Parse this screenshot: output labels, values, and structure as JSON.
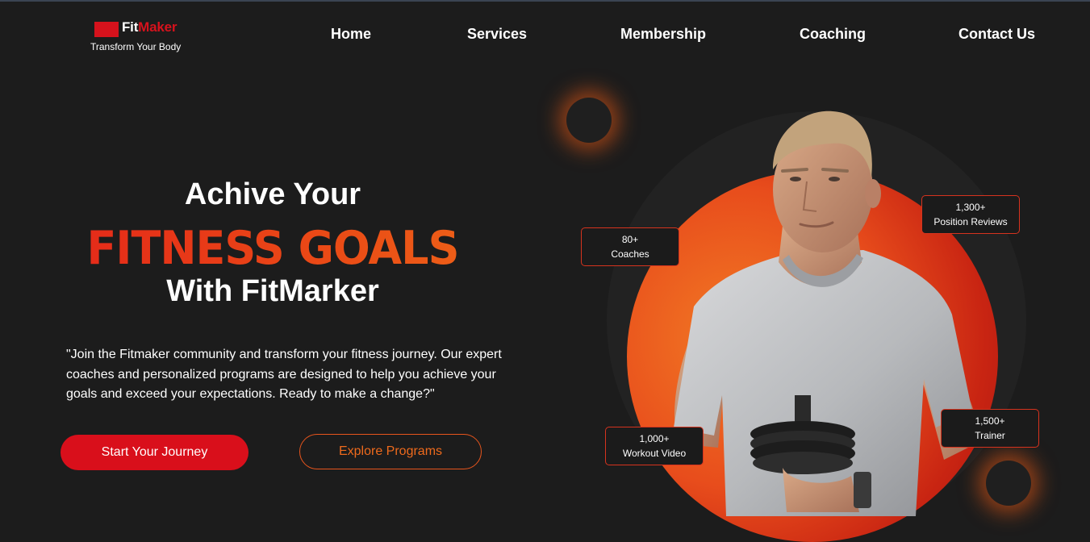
{
  "brand": {
    "name_part1": "Fit",
    "name_part2": "Maker",
    "tagline": "Transform Your Body"
  },
  "nav": [
    {
      "label": "Home"
    },
    {
      "label": "Services"
    },
    {
      "label": "Membership"
    },
    {
      "label": "Coaching"
    },
    {
      "label": "Contact Us"
    }
  ],
  "hero": {
    "line1": "Achive Your",
    "highlight": "FITNESS GOALS",
    "line3": "With FitMarker",
    "description": "\"Join the Fitmaker community and transform your fitness journey. Our expert coaches and personalized programs are designed to help you achieve your goals and exceed your expectations. Ready to make a change?\"",
    "primary_button": "Start Your Journey",
    "secondary_button": "Explore Programs"
  },
  "stats": [
    {
      "value": "80+",
      "label": "Coaches"
    },
    {
      "value": "1,300+",
      "label": "Position Reviews"
    },
    {
      "value": "1,000+",
      "label": "Workout Video"
    },
    {
      "value": "1,500+",
      "label": "Trainer"
    }
  ],
  "colors": {
    "accent_red": "#d90f1b",
    "accent_orange": "#ee6a1c",
    "background": "#1c1c1c"
  }
}
